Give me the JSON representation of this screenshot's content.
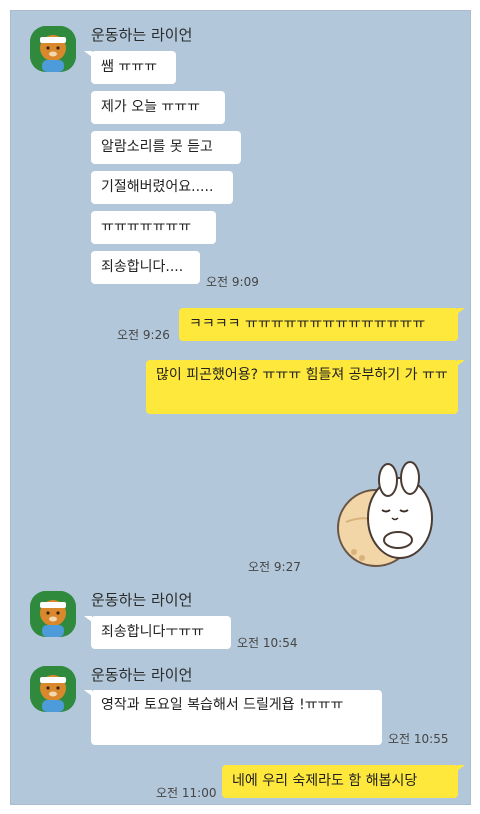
{
  "sender_name": "운동하는 라이언",
  "messages": [
    {
      "text": "쌤 ㅠㅠㅠ"
    },
    {
      "text": "제가 오늘 ㅠㅠㅠ"
    },
    {
      "text": "알람소리를 못 듣고"
    },
    {
      "text": "기절해버렸어요....."
    },
    {
      "text": "ㅠㅠㅠㅠㅠㅠㅠ"
    },
    {
      "text": "죄송합니다....",
      "time": "오전 9:09"
    },
    {
      "text": "ㅋㅋㅋㅋ ㅠㅠㅠㅠㅠㅠㅠㅠㅠㅠㅠㅠㅠㅠ",
      "time": "오전 9:26"
    },
    {
      "text": "많이 피곤했어용? ㅠㅠㅠ 힘들져 공부하기 가 ㅠㅠ"
    },
    {
      "time": "오전 9:27",
      "sticker": "sleepy-bunny-sticker"
    },
    {
      "text": "죄송합니다ㅜㅠㅠ",
      "time": "오전 10:54"
    },
    {
      "text": "영작과 토요일 복습해서 드릴게욥 !ㅠㅠㅠ",
      "time": "오전 10:55"
    },
    {
      "text": "네에 우리 숙제라도 함 해봅시당",
      "time": "오전 11:00"
    }
  ],
  "colors": {
    "chat_background": "#b2c7da",
    "my_bubble": "#fde83b",
    "their_bubble": "#ffffff",
    "avatar_background": "#2f8a3e"
  }
}
